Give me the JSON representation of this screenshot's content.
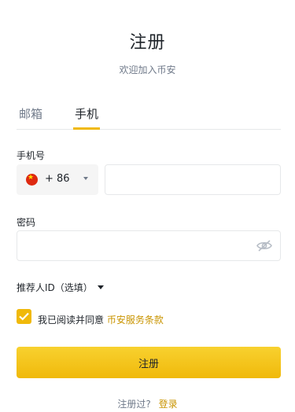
{
  "page": {
    "title": "注册",
    "subtitle": "欢迎加入币安"
  },
  "tabs": [
    {
      "label": "邮箱",
      "active": false
    },
    {
      "label": "手机",
      "active": true
    }
  ],
  "phone": {
    "label": "手机号",
    "country_code": "+ 86",
    "country_flag": "cn-flag-icon",
    "value": "",
    "placeholder": ""
  },
  "password": {
    "label": "密码",
    "value": "",
    "placeholder": "",
    "visibility_icon": "eye-hidden-icon"
  },
  "referral": {
    "label": "推荐人ID（选填）"
  },
  "agreement": {
    "checked": true,
    "text": "我已阅读并同意",
    "link_text": "币安服务条款"
  },
  "submit": {
    "label": "注册"
  },
  "footer": {
    "question": "注册过?",
    "login_link": "登录"
  },
  "colors": {
    "accent": "#f0b90b",
    "link": "#c99400",
    "text": "#1e2329",
    "muted": "#707a8a"
  }
}
